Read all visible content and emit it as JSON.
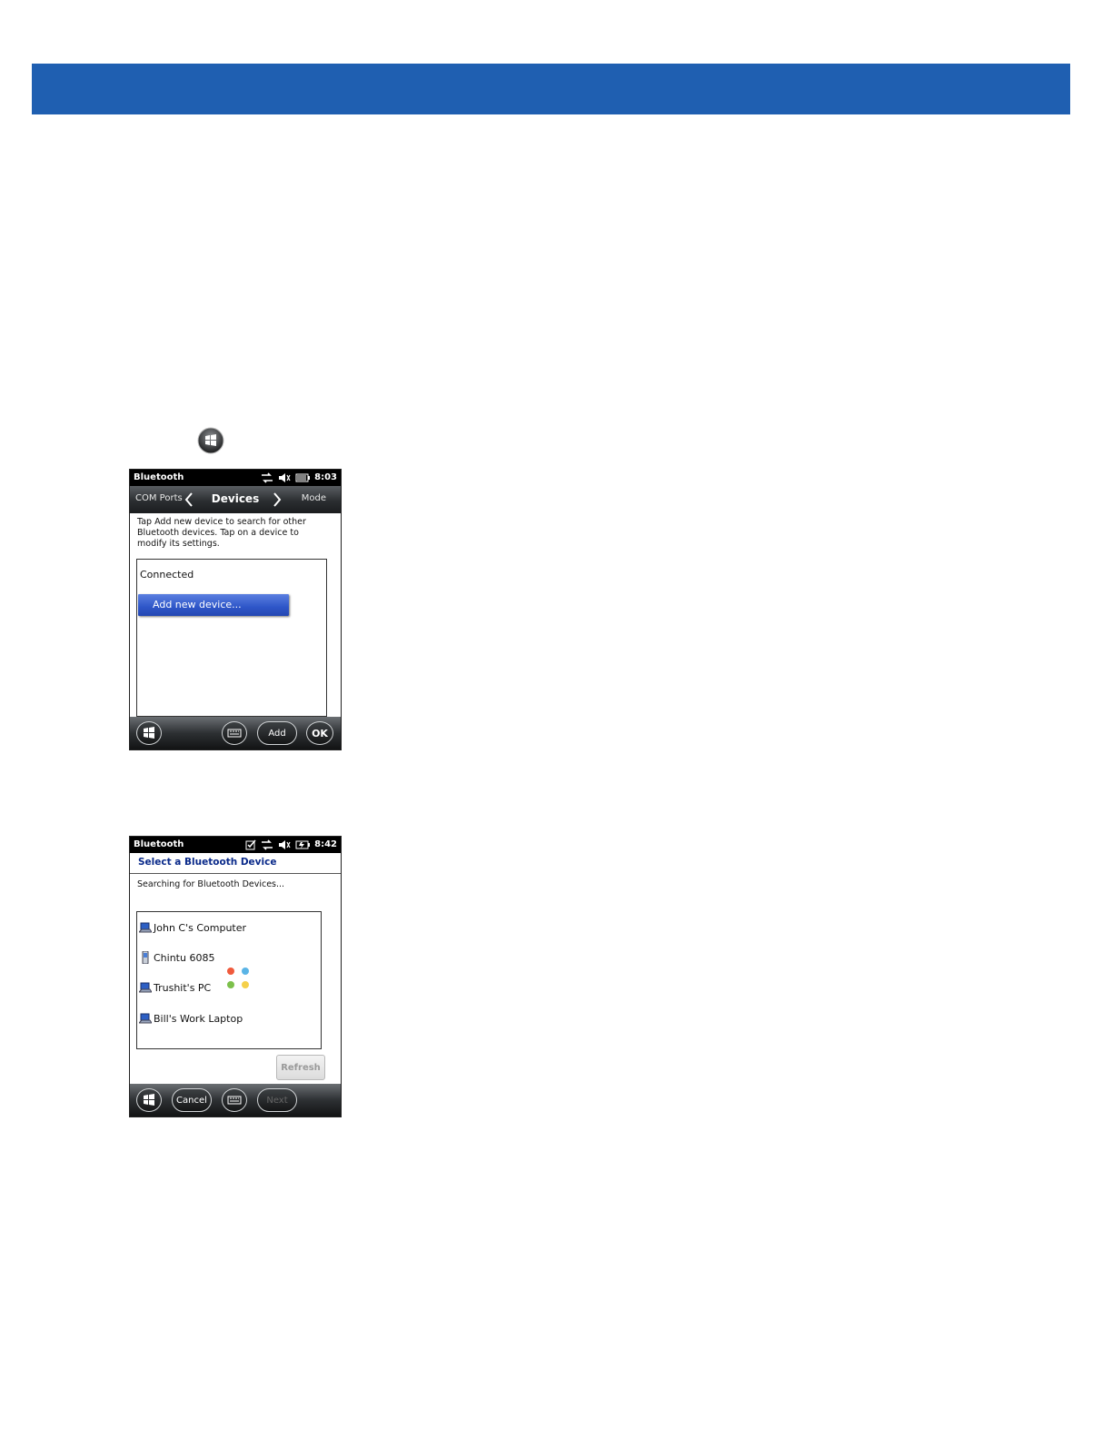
{
  "screen1": {
    "status": {
      "app_title": "Bluetooth",
      "time": "8:03"
    },
    "nav": {
      "left_tab": "COM Ports",
      "current_tab": "Devices",
      "right_tab": "Mode"
    },
    "description": "Tap Add new device to search for other Bluetooth devices. Tap on a device to modify its settings.",
    "list": {
      "section_label": "Connected",
      "add_item": "Add new device..."
    },
    "bottom": {
      "add_label": "Add",
      "ok_label": "OK"
    }
  },
  "screen2": {
    "status": {
      "app_title": "Bluetooth",
      "time": "8:42"
    },
    "title": "Select a Bluetooth Device",
    "searching": "Searching for Bluetooth Devices...",
    "devices": [
      {
        "name": "John C's Computer",
        "icon": "computer-icon"
      },
      {
        "name": "Chintu 6085",
        "icon": "phone-icon"
      },
      {
        "name": "Trushit's PC",
        "icon": "computer-icon"
      },
      {
        "name": "Bill's Work Laptop",
        "icon": "computer-icon"
      }
    ],
    "refresh_label": "Refresh",
    "bottom": {
      "cancel_label": "Cancel",
      "next_label": "Next"
    }
  },
  "colors": {
    "banner": "#1f5fb1",
    "selection": "#2e56c8",
    "title_text": "#0a2a8a"
  }
}
